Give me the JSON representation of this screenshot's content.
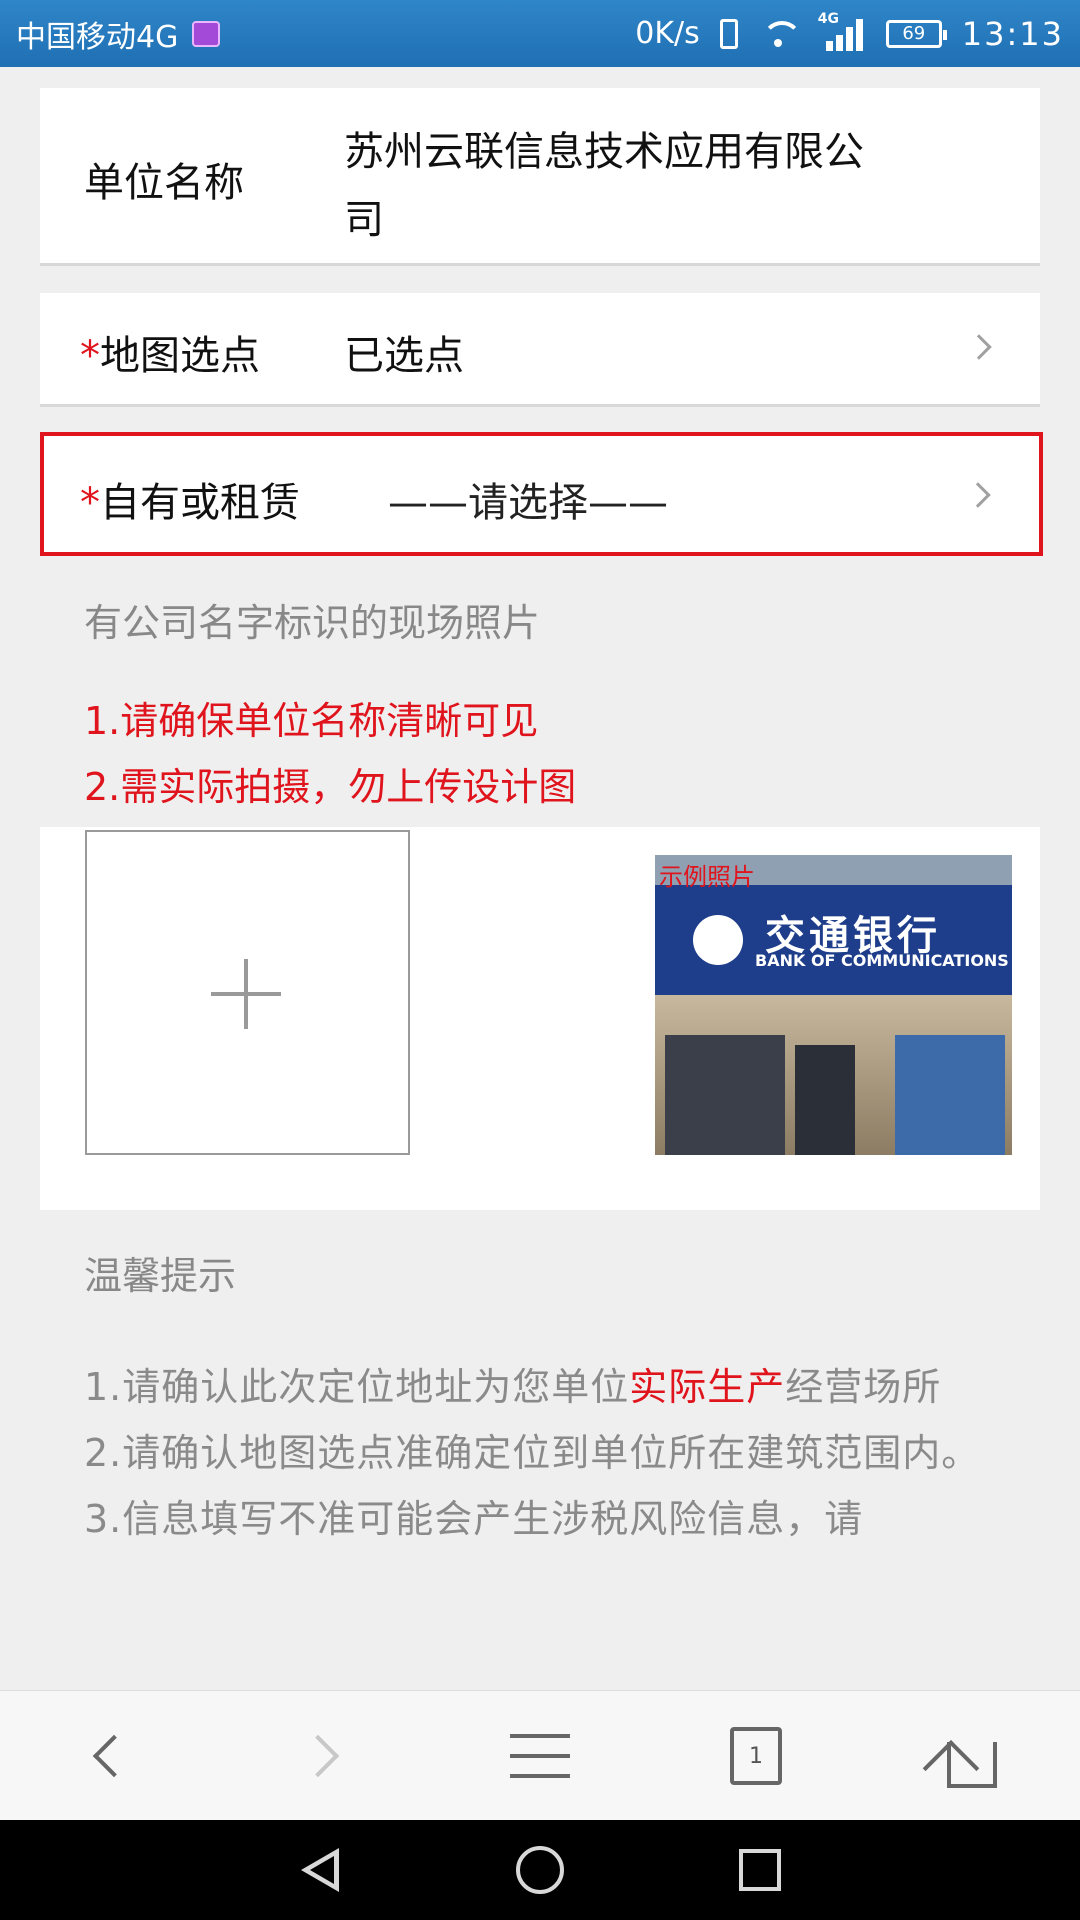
{
  "status": {
    "carrier": "中国移动4G",
    "speed": "0K/s",
    "network_tag": "4G",
    "battery": "69",
    "time": "13:13",
    "icons": [
      "gallery-icon",
      "vibrate-icon",
      "wifi-icon",
      "signal-icon",
      "battery-icon"
    ]
  },
  "form": {
    "company": {
      "label": "单位名称",
      "value_line1": "苏州云联信息技术应用有限公",
      "value_line2": "司"
    },
    "map": {
      "star": "*",
      "label": "地图选点",
      "value": "已选点"
    },
    "ownership": {
      "star": "*",
      "label": "自有或租赁",
      "placeholder": "——请选择——"
    }
  },
  "photo": {
    "title": "有公司名字标识的现场照片",
    "req1": "1.请确保单位名称清晰可见",
    "req2": "2.需实际拍摄，勿上传设计图",
    "example_label": "示例照片",
    "example_sign_cn": "交通银行",
    "example_sign_en": "BANK OF COMMUNICATIONS"
  },
  "tips": {
    "title": "温馨提示",
    "tip1_pre": "1.请确认此次定位地址为您单位",
    "tip1_highlight": "实际生产",
    "tip1_post": "经营场所",
    "tip2": "2.请确认地图选点准确定位到单位所在建筑范围内。",
    "tip3": "3.信息填写不准可能会产生涉税风险信息，请"
  },
  "toolbar": {
    "tabs_count": "1"
  },
  "colors": {
    "accent_red": "#e0141d",
    "statusbar_blue": "#2a7fc1"
  }
}
